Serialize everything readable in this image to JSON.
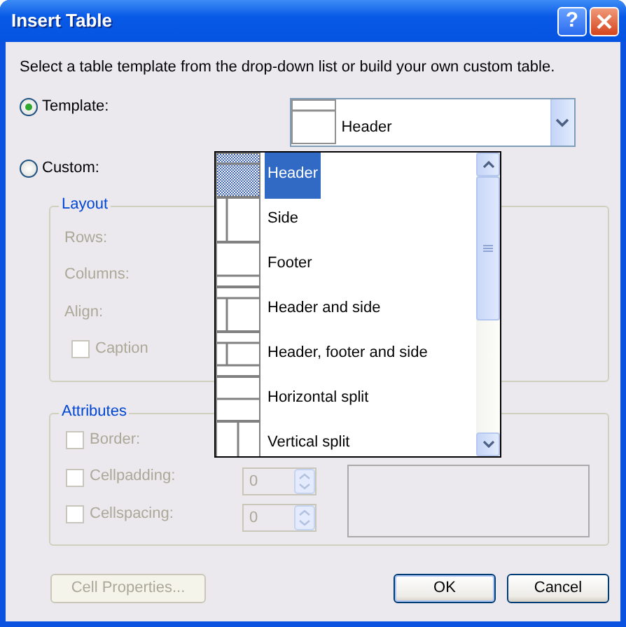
{
  "window": {
    "title": "Insert Table",
    "help_button": "?"
  },
  "instruction": "Select a table template from the drop-down list or build your own custom table.",
  "mode_options": [
    {
      "label": "Template:",
      "selected": true
    },
    {
      "label": "Custom:",
      "selected": false
    }
  ],
  "template_combo": {
    "value": "Header",
    "kind": "header",
    "expanded": true
  },
  "template_list": [
    {
      "label": "Header",
      "kind": "header",
      "selected": true
    },
    {
      "label": "Side",
      "kind": "side",
      "selected": false
    },
    {
      "label": "Footer",
      "kind": "footer",
      "selected": false
    },
    {
      "label": "Header and side",
      "kind": "header_side",
      "selected": false
    },
    {
      "label": "Header, footer and side",
      "kind": "header_footer_side",
      "selected": false
    },
    {
      "label": "Horizontal split",
      "kind": "hsplit",
      "selected": false
    },
    {
      "label": "Vertical split",
      "kind": "vsplit",
      "selected": false
    }
  ],
  "layout": {
    "title": "Layout",
    "disabled": true,
    "fields": [
      {
        "label": "Rows:"
      },
      {
        "label": "Columns:"
      },
      {
        "label": "Align:"
      }
    ],
    "caption": {
      "label": "Caption",
      "checked": false
    }
  },
  "attributes": {
    "title": "Attributes",
    "disabled": true,
    "items": [
      {
        "label": "Border:",
        "checked": false
      },
      {
        "label": "Cellpadding:",
        "checked": false,
        "value": "0"
      },
      {
        "label": "Cellspacing:",
        "checked": false,
        "value": "0"
      }
    ]
  },
  "buttons": [
    {
      "label": "Cell Properties...",
      "disabled": true,
      "default": false
    },
    {
      "label": "OK",
      "disabled": false,
      "default": true
    },
    {
      "label": "Cancel",
      "disabled": false,
      "default": false
    }
  ]
}
